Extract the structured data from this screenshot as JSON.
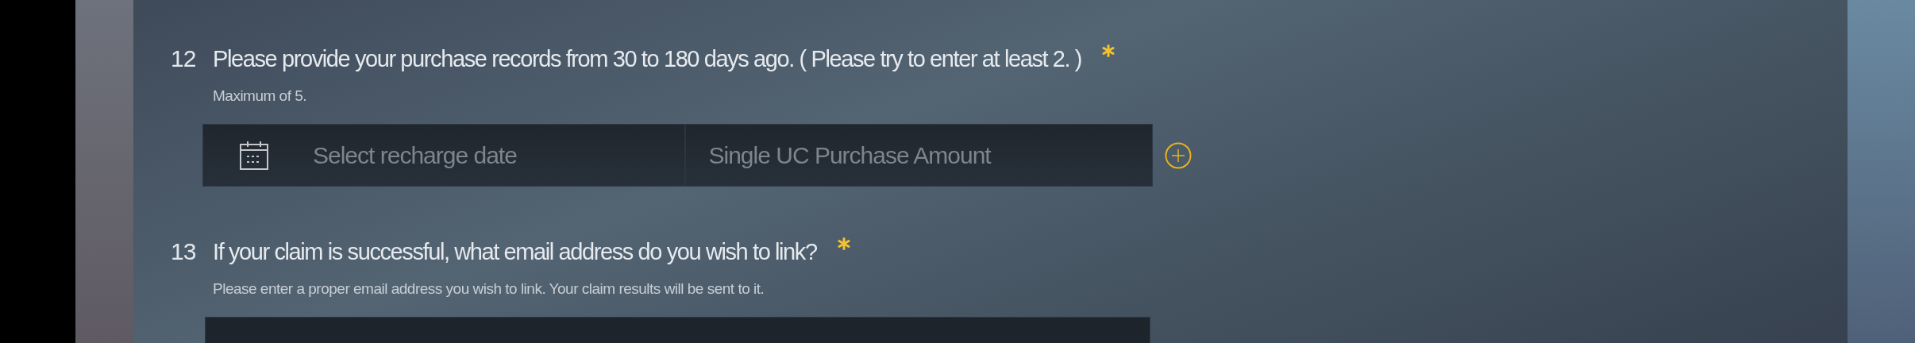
{
  "questions": [
    {
      "number": "12",
      "title": "Please provide your purchase records from 30 to 180 days ago. ( Please try to enter at least 2. )",
      "required": true,
      "note": "Maximum of 5.",
      "kind": "records",
      "date_placeholder": "Select recharge date",
      "amount_placeholder": "Single UC Purchase Amount"
    },
    {
      "number": "13",
      "title": "If your claim is successful, what email address do you wish to link?",
      "required": true,
      "note": "Please enter a proper email address you wish to link. Your claim results will be sent to it.",
      "kind": "text"
    }
  ]
}
